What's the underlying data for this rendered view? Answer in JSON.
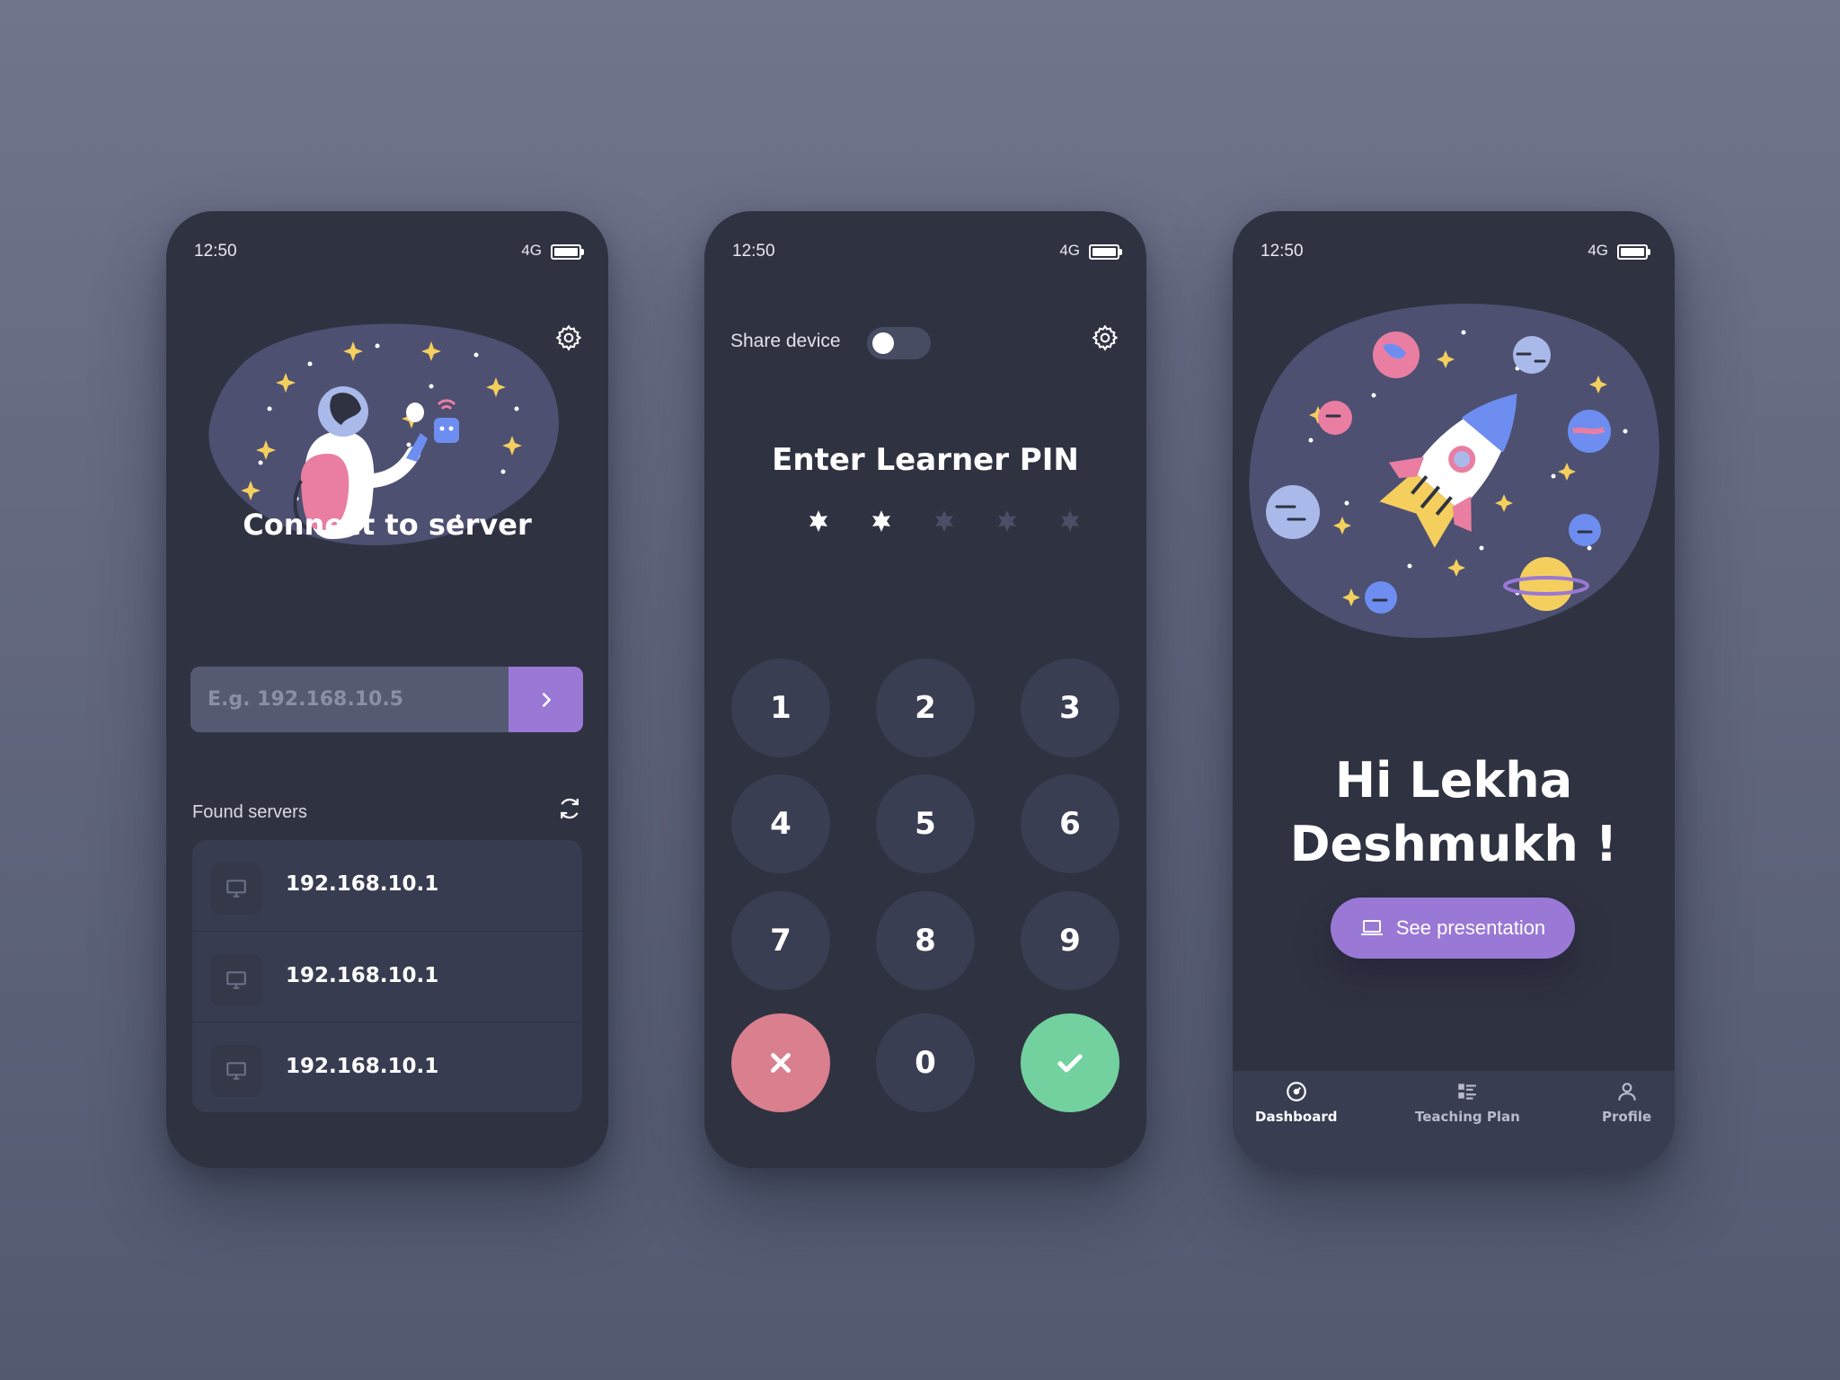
{
  "colors": {
    "background": "#676b83",
    "phone": "#2f3241",
    "accent": "#9a78d6",
    "cancel": "#d97f8e",
    "confirm": "#72d19f",
    "star": "#f4cf5e"
  },
  "status_bar": {
    "time": "12:50",
    "network": "4G"
  },
  "connect_screen": {
    "title": "Connect to server",
    "input_placeholder": "E.g. 192.168.10.5",
    "found_servers_label": "Found servers",
    "servers": [
      "192.168.10.1",
      "192.168.10.1",
      "192.168.10.1"
    ],
    "icons": [
      "gear-icon",
      "chevron-right-icon",
      "refresh-icon",
      "monitor-icon"
    ]
  },
  "pin_screen": {
    "share_device_label": "Share device",
    "share_device_enabled": false,
    "title": "Enter Learner PIN",
    "pin_length": 5,
    "pin_entered": 2,
    "keys": [
      "1",
      "2",
      "3",
      "4",
      "5",
      "6",
      "7",
      "8",
      "9",
      "0"
    ]
  },
  "dashboard_screen": {
    "greeting_line1": "Hi Lekha",
    "greeting_line2": "Deshmukh !",
    "presentation_button": "See presentation",
    "nav": [
      {
        "label": "Dashboard",
        "icon": "dashboard-icon",
        "active": true
      },
      {
        "label": "Teaching Plan",
        "icon": "list-icon",
        "active": false
      },
      {
        "label": "Profile",
        "icon": "user-icon",
        "active": false
      }
    ]
  }
}
